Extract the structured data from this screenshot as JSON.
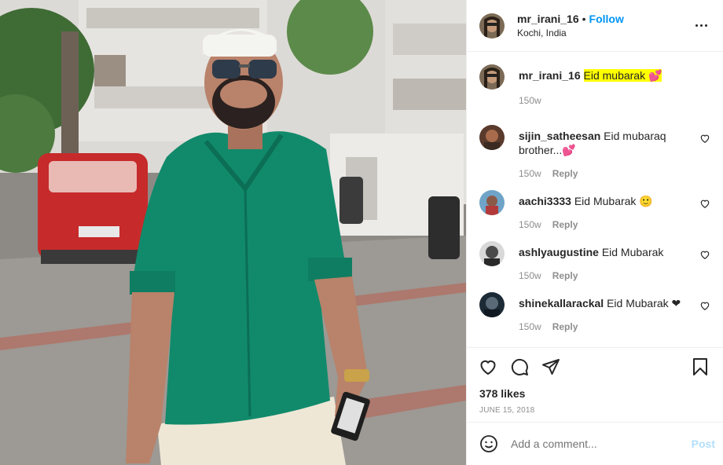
{
  "header": {
    "username": "mr_irani_16",
    "dot": "•",
    "follow_label": "Follow",
    "location": "Kochi, India"
  },
  "caption": {
    "username": "mr_irani_16",
    "text": "Eid mubarak 💕",
    "age": "150w"
  },
  "comments": [
    {
      "username": "sijin_satheesan",
      "text": "Eid mubaraq brother...💕",
      "age": "150w",
      "reply_label": "Reply"
    },
    {
      "username": "aachi3333",
      "text": "Eid Mubarak 🙂",
      "age": "150w",
      "reply_label": "Reply"
    },
    {
      "username": "ashlyaugustine",
      "text": "Eid Mubarak",
      "age": "150w",
      "reply_label": "Reply"
    },
    {
      "username": "shinekallarackal",
      "text": "Eid Mubarak ❤",
      "age": "150w",
      "reply_label": "Reply"
    }
  ],
  "likes": "378 likes",
  "date": "JUNE 15, 2018",
  "add_comment": {
    "placeholder": "Add a comment...",
    "post_label": "Post"
  },
  "icons": {
    "like": "heart-icon",
    "comment": "comment-icon",
    "share": "send-icon",
    "save": "bookmark-icon",
    "more": "more-options-icon",
    "emoji": "emoji-icon"
  },
  "colors": {
    "follow": "#0095f6",
    "post_disabled": "#b2dffc",
    "highlight": "#ffff00",
    "muted": "#8e8e8e"
  }
}
